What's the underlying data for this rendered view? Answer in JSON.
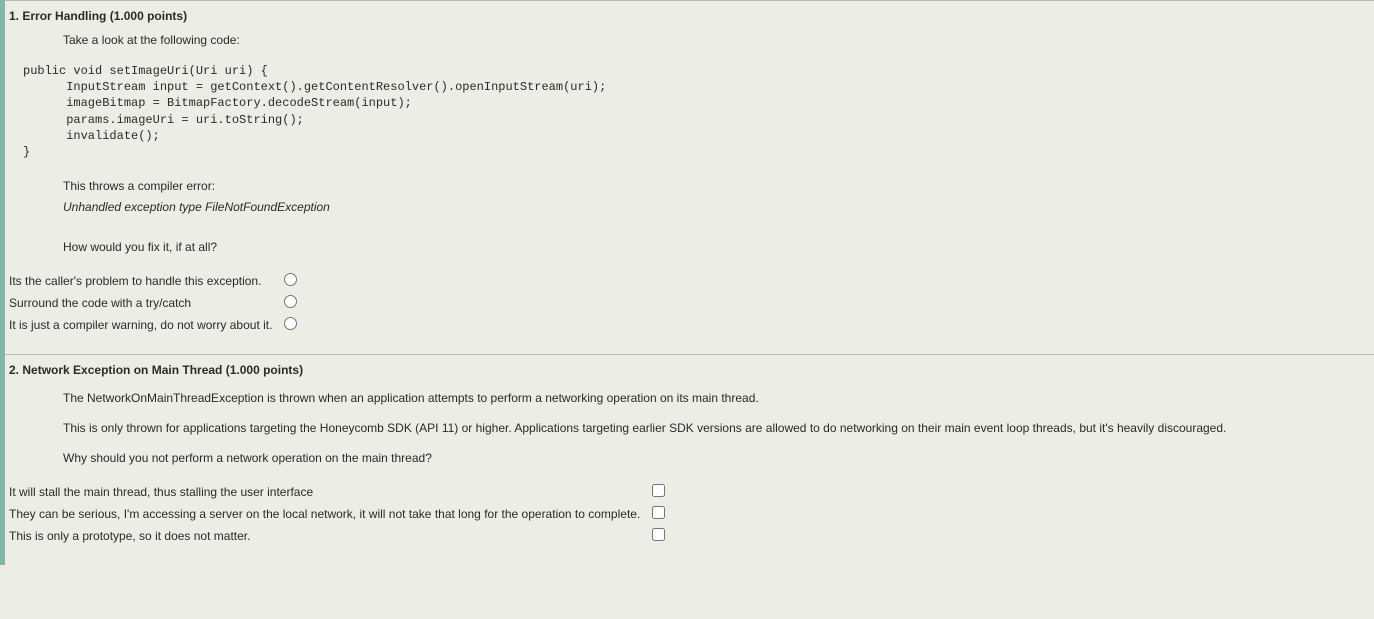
{
  "questions": [
    {
      "number": "1.",
      "title": "Error Handling",
      "points": "(1.000 points)",
      "intro": "Take a look at the following code:",
      "code": "public void setImageUri(Uri uri) {\n      InputStream input = getContext().getContentResolver().openInputStream(uri);\n      imageBitmap = BitmapFactory.decodeStream(input);\n      params.imageUri = uri.toString();\n      invalidate();\n}",
      "post_line1": "This throws a compiler error:",
      "post_italic": "Unhandled exception type FileNotFoundException",
      "post_line2": "How would you fix it, if at all?",
      "input_type": "radio",
      "options": [
        "Its the caller's problem to handle this exception.",
        "Surround the code with a try/catch",
        "It is just a compiler warning, do not worry about it."
      ]
    },
    {
      "number": "2.",
      "title": "Network Exception on Main Thread",
      "points": "(1.000 points)",
      "paragraphs": [
        "The NetworkOnMainThreadException is thrown when an application attempts to perform a networking operation on its main thread.",
        "This is only thrown for applications targeting the Honeycomb SDK (API 11) or higher. Applications targeting earlier SDK versions are allowed to do networking on their main event loop threads, but it's heavily discouraged.",
        "Why should you not perform a network operation on the main thread?"
      ],
      "input_type": "checkbox",
      "options": [
        "It will stall the main thread, thus stalling the user interface",
        "They can be serious, I'm accessing a server on the local network, it will not  take that long for the operation to complete.",
        "This is only a prototype, so it does not matter."
      ]
    }
  ]
}
